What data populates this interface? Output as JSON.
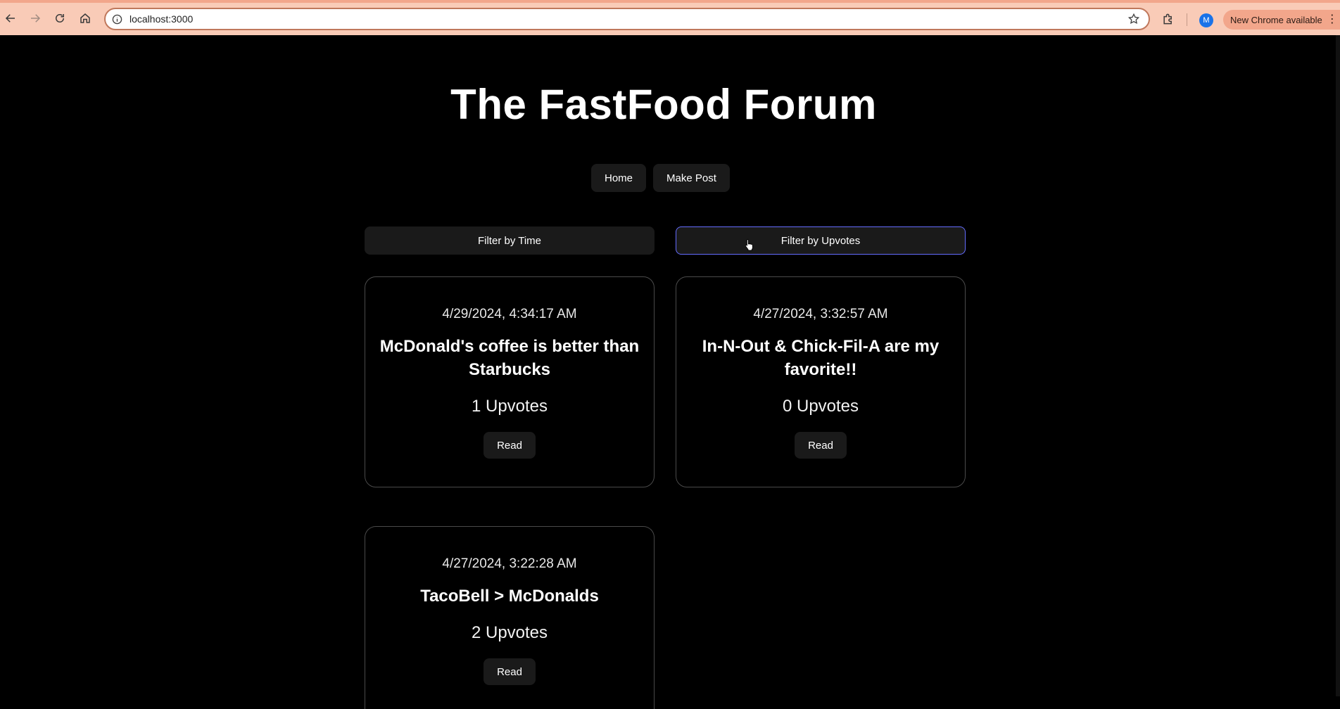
{
  "browser": {
    "url": "localhost:3000",
    "profile_initial": "M",
    "update_label": "New Chrome available",
    "menu_glyph": "⋮",
    "accent_color": "#f9cbb7"
  },
  "site": {
    "title": "The FastFood Forum"
  },
  "nav": {
    "home_label": "Home",
    "make_post_label": "Make Post"
  },
  "filters": {
    "time_label": "Filter by Time",
    "upvotes_label": "Filter by Upvotes",
    "focus_color": "#646cff"
  },
  "posts": [
    {
      "date": "4/29/2024, 4:34:17 AM",
      "title": "McDonald's coffee is better than Starbucks",
      "upvotes": "1 Upvotes",
      "read_label": "Read"
    },
    {
      "date": "4/27/2024, 3:32:57 AM",
      "title": "In-N-Out & Chick-Fil-A are my favorite!!",
      "upvotes": "0 Upvotes",
      "read_label": "Read"
    },
    {
      "date": "4/27/2024, 3:22:28 AM",
      "title": "TacoBell > McDonalds",
      "upvotes": "2 Upvotes",
      "read_label": "Read"
    }
  ]
}
